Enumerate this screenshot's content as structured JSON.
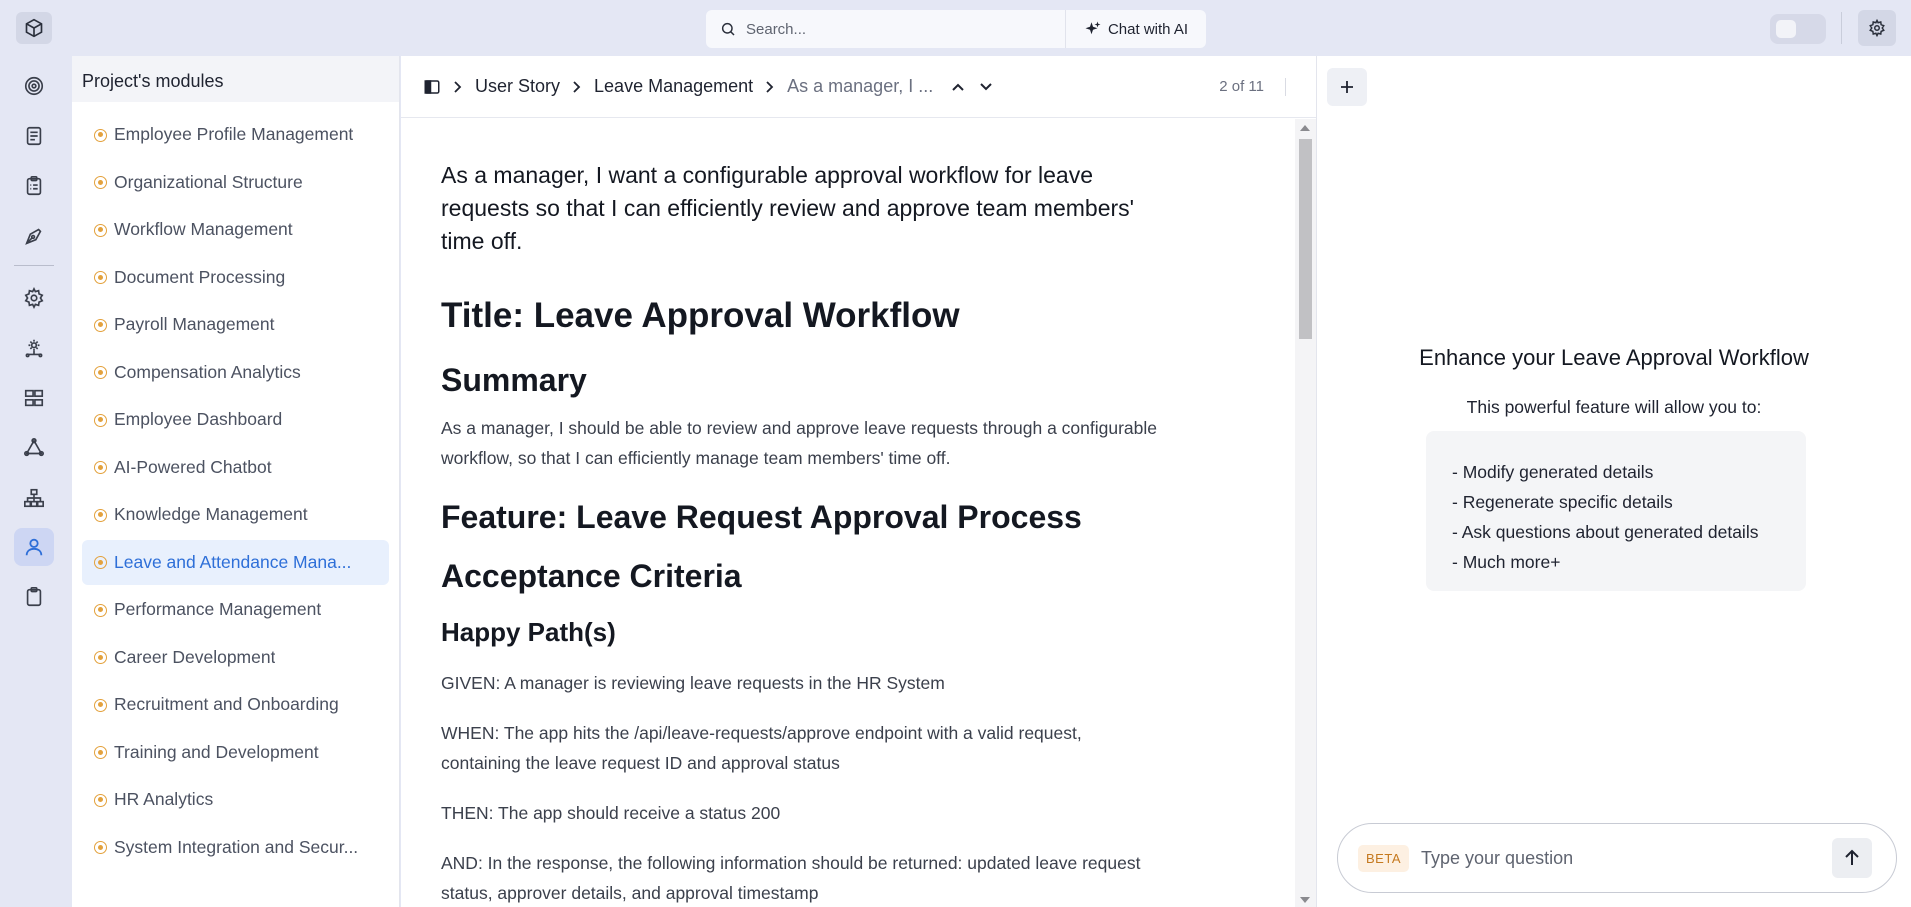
{
  "topbar": {
    "search_placeholder": "Search...",
    "chat_ai_label": "Chat with AI"
  },
  "rail": {
    "icons": [
      "target-icon",
      "document-icon",
      "clipboard-list-icon",
      "pen-tool-icon",
      "settings-icon",
      "gear-network-icon",
      "layout-grid-icon",
      "triangle-nodes-icon",
      "hierarchy-icon",
      "user-icon",
      "clipboard-icon"
    ],
    "active": "user-icon"
  },
  "modules": {
    "title": "Project's modules",
    "items": [
      {
        "label": "Employee Profile Management"
      },
      {
        "label": "Organizational Structure"
      },
      {
        "label": "Workflow Management"
      },
      {
        "label": "Document Processing"
      },
      {
        "label": "Payroll Management"
      },
      {
        "label": "Compensation Analytics"
      },
      {
        "label": "Employee Dashboard"
      },
      {
        "label": "AI-Powered Chatbot"
      },
      {
        "label": "Knowledge Management"
      },
      {
        "label": "Leave and Attendance Mana..."
      },
      {
        "label": "Performance Management"
      },
      {
        "label": "Career Development"
      },
      {
        "label": "Recruitment and Onboarding"
      },
      {
        "label": "Training and Development"
      },
      {
        "label": "HR Analytics"
      },
      {
        "label": "System Integration and Secur..."
      }
    ],
    "active_index": 9
  },
  "doc": {
    "breadcrumb": [
      "User Story",
      "Leave Management",
      "As a manager, I ..."
    ],
    "counter": "2 of 11",
    "story": "As a manager, I want a configurable approval workflow for leave requests so that I can efficiently review and approve team members' time off.",
    "title": "Title: Leave Approval Workflow",
    "summary_heading": "Summary",
    "summary": "As a manager, I should be able to review and approve leave requests through a configurable workflow, so that I can efficiently manage team members' time off.",
    "feature": "Feature: Leave Request Approval Process",
    "acceptance_heading": "Acceptance Criteria",
    "happy_path_heading": "Happy Path(s)",
    "given": "GIVEN: A manager is reviewing leave requests in the HR System",
    "when": "WHEN: The app hits the /api/leave-requests/approve endpoint with a valid request, containing the leave request ID and approval status",
    "then": "THEN: The app should receive a status 200",
    "and": "AND: In the response, the following information should be returned: updated leave request status, approver details, and approval timestamp"
  },
  "assistant": {
    "title": "Enhance your Leave Approval Workflow",
    "subtitle": "This powerful feature will allow you to:",
    "features": [
      "- Modify generated details",
      "- Regenerate specific details",
      "- Ask questions about generated details",
      "- Much more+"
    ],
    "beta_label": "BETA",
    "input_placeholder": "Type your question"
  },
  "colors": {
    "accent": "#2e6fd8",
    "module_dot": "#e3a13c",
    "app_bg": "#e4e7f4"
  }
}
